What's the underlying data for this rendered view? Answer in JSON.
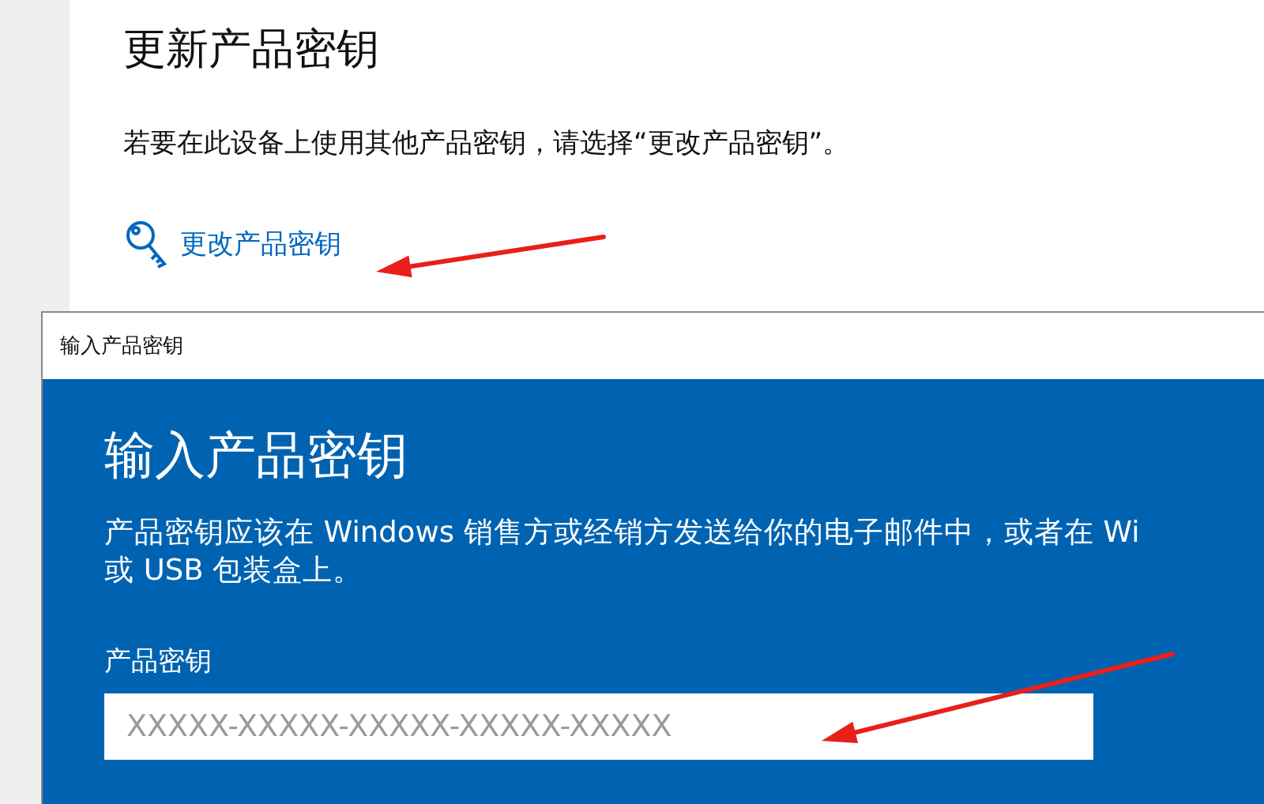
{
  "settings": {
    "heading": "更新产品密钥",
    "description": "若要在此设备上使用其他产品密钥，请选择“更改产品密钥”。",
    "change_key_link": "更改产品密钥"
  },
  "dialog": {
    "title": "输入产品密钥",
    "heading": "输入产品密钥",
    "description_lines": [
      "产品密钥应该在 Windows 销售方或经销方发送给你的电子邮件中，或者在 Wi",
      "或 USB 包装盒上。"
    ],
    "field_label": "产品密钥",
    "key_field": {
      "placeholder": "XXXXX-XXXXX-XXXXX-XXXXX-XXXXX"
    }
  },
  "annotations": [
    {
      "kind": "arrow"
    },
    {
      "kind": "arrow"
    }
  ]
}
